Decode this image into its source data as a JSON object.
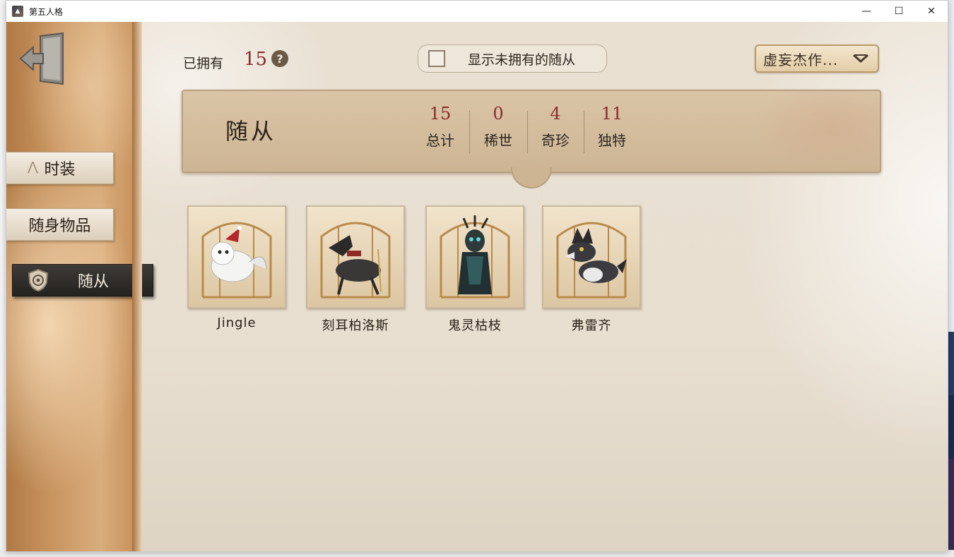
{
  "window": {
    "title": "第五人格",
    "controls": [
      "—",
      "☐",
      "✕"
    ]
  },
  "header": {
    "owned_label": "已拥有",
    "owned_count": "15",
    "help": "?",
    "toggle_label": "显示未拥有的随从",
    "toggle_checked": false,
    "filter_label": "虚妄杰作..."
  },
  "sidebar": {
    "items": [
      {
        "label": "时装",
        "active": false
      },
      {
        "label": "随身物品",
        "active": false
      },
      {
        "label": "随从",
        "active": true
      }
    ]
  },
  "banner": {
    "title": "随从",
    "stats": [
      {
        "value": "15",
        "label": "总计"
      },
      {
        "value": "0",
        "label": "稀世"
      },
      {
        "value": "4",
        "label": "奇珍"
      },
      {
        "value": "11",
        "label": "独特"
      }
    ]
  },
  "pets": [
    {
      "name": "Jingle",
      "icon": "white-dog-santa-hat-icon"
    },
    {
      "name": "刻耳柏洛斯",
      "icon": "black-hound-icon"
    },
    {
      "name": "鬼灵枯枝",
      "icon": "tree-spirit-icon"
    },
    {
      "name": "弗雷齐",
      "icon": "grey-wolf-icon"
    }
  ],
  "colors": {
    "accent_red": "#8a2b2b",
    "active_nav": "#2f2c29",
    "parchment": "#e8dfd1"
  }
}
